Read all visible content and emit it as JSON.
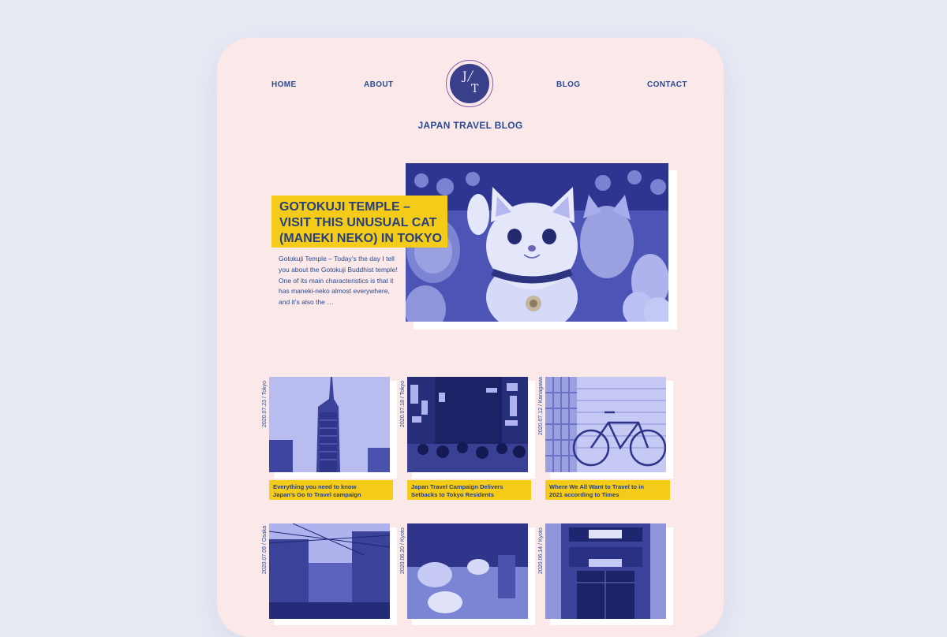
{
  "nav": {
    "home": "HOME",
    "about": "ABOUT",
    "blog": "BLOG",
    "contact": "CONTACT"
  },
  "logo": {
    "letter1": "J",
    "letter2": "T"
  },
  "site_title": "JAPAN TRAVEL BLOG",
  "hero": {
    "title_lines": [
      "GOTOKUJI TEMPLE –",
      "VISIT THIS UNUSUAL CAT",
      "(MANEKI NEKO) IN TOKYO"
    ],
    "excerpt": "Gotokuji Temple – Today’s the day I tell you about the Gotokuji Buddhist temple! One of its main characteristics is that it has maneki-neko almost everywhere, and it’s also the …",
    "image_icon": "maneki-neko-photo"
  },
  "posts": [
    {
      "date": "2020.07.23 / Tokyo",
      "title_lines": [
        "Everything you need to know",
        "Japan’s Go to Travel campaign"
      ],
      "image_icon": "skyscraper-photo"
    },
    {
      "date": "2020.07.18 / Tokyo",
      "title_lines": [
        "Japan Travel Campaign Delivers",
        "Setbacks to Tokyo Residents"
      ],
      "image_icon": "night-street-photo"
    },
    {
      "date": "2020.07.12 / Kanagawa",
      "title_lines": [
        "Where We All Want to Travel to in",
        "2021 according to Times"
      ],
      "image_icon": "bicycle-photo"
    },
    {
      "date": "2020.07.09 / Osaka",
      "title_lines": [],
      "image_icon": "osaka-street-photo"
    },
    {
      "date": "2020.06.20 / Kyoto",
      "title_lines": [],
      "image_icon": "teapot-photo"
    },
    {
      "date": "2020.06.14 / Kyoto",
      "title_lines": [],
      "image_icon": "kyoto-shop-photo"
    }
  ],
  "colors": {
    "accent_yellow": "#f5cb1a",
    "primary_blue": "#2a4a93",
    "photo_tint": "#4a51b8",
    "card_background": "#fbe9ea",
    "page_background": "#e8eaf4"
  }
}
